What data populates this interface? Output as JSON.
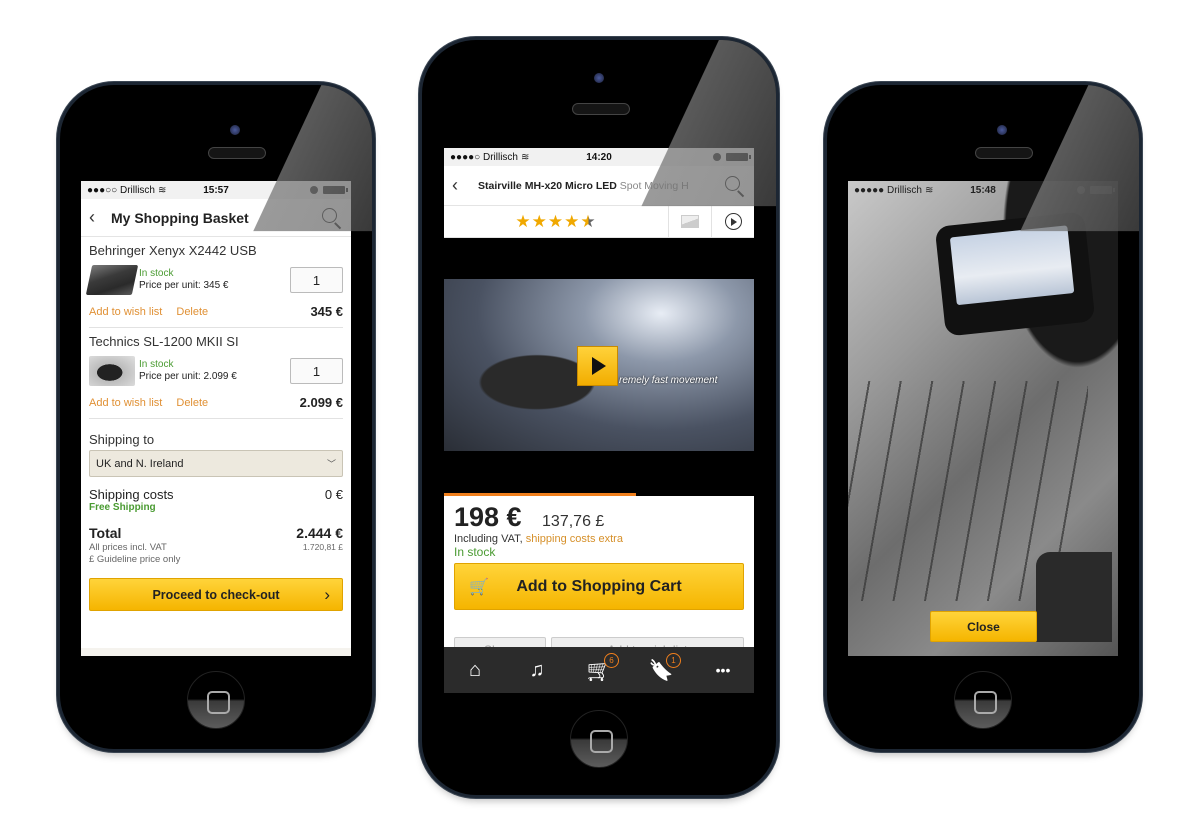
{
  "phones": {
    "basket": {
      "status": {
        "carrier": "●●●○○ Drillisch",
        "wifi_icon": "wifi-icon",
        "time": "15:57"
      },
      "header": {
        "back_icon": "chevron-left-icon",
        "title": "My Shopping Basket",
        "search_icon": "search-icon"
      },
      "items": [
        {
          "name": "Behringer Xenyx X2442 USB",
          "stock": "In stock",
          "unit_price": "Price per unit: 345 €",
          "qty": "1",
          "wishlist": "Add to wish list",
          "delete": "Delete",
          "price": "345 €"
        },
        {
          "name": "Technics SL-1200 MKII SI",
          "stock": "In stock",
          "unit_price": "Price per unit: 2.099 €",
          "qty": "1",
          "wishlist": "Add to wish list",
          "delete": "Delete",
          "price": "2.099 €"
        }
      ],
      "shipping": {
        "label": "Shipping to",
        "selected": "UK and N. Ireland",
        "costs_label": "Shipping costs",
        "costs_value": "0 €",
        "free_label": "Free Shipping"
      },
      "total": {
        "label": "Total",
        "value": "2.444 €",
        "vat_note": "All prices incl. VAT",
        "gbp_value": "1.720,81 £",
        "gbp_note": "£ Guideline price only"
      },
      "checkout_button": "Proceed to check-out"
    },
    "product": {
      "status": {
        "carrier": "●●●●○ Drillisch",
        "wifi_icon": "wifi-icon",
        "time": "14:20"
      },
      "header": {
        "back_icon": "chevron-left-icon",
        "title_bold": "Stairville MH-x20 Micro LED",
        "title_rest": " Spot Moving H",
        "search_icon": "search-icon"
      },
      "rating": {
        "stars_text": "★★★★",
        "half_star": "★",
        "value": 4.5,
        "max": 5
      },
      "video": {
        "caption": "remely fast movement",
        "progress": 0.62
      },
      "price": {
        "eur": "198 €",
        "gbp": "137,76 £",
        "vat_text": "Including VAT, ",
        "shipping_link": "shipping costs extra",
        "stock": "In stock"
      },
      "add_to_cart": "Add to Shopping Cart",
      "secondary_buttons": [
        "Share",
        "Add to wish list"
      ],
      "tabbar": {
        "items": [
          {
            "name": "home",
            "icon": "⌂"
          },
          {
            "name": "instruments",
            "icon": "♫"
          },
          {
            "name": "cart",
            "icon": "🛒",
            "badge": "6"
          },
          {
            "name": "wishlist",
            "icon": "🔖",
            "badge": "1"
          },
          {
            "name": "more",
            "icon": "•••"
          }
        ]
      }
    },
    "gallery": {
      "status": {
        "carrier": "●●●●● Drillisch",
        "wifi_icon": "wifi-icon",
        "time": "15:48"
      },
      "close_button": "Close"
    }
  },
  "colors": {
    "accent_yellow": "#f5b500",
    "link_orange": "#e09034",
    "stock_green": "#4a9b32",
    "badge_orange": "#f07f1c"
  }
}
